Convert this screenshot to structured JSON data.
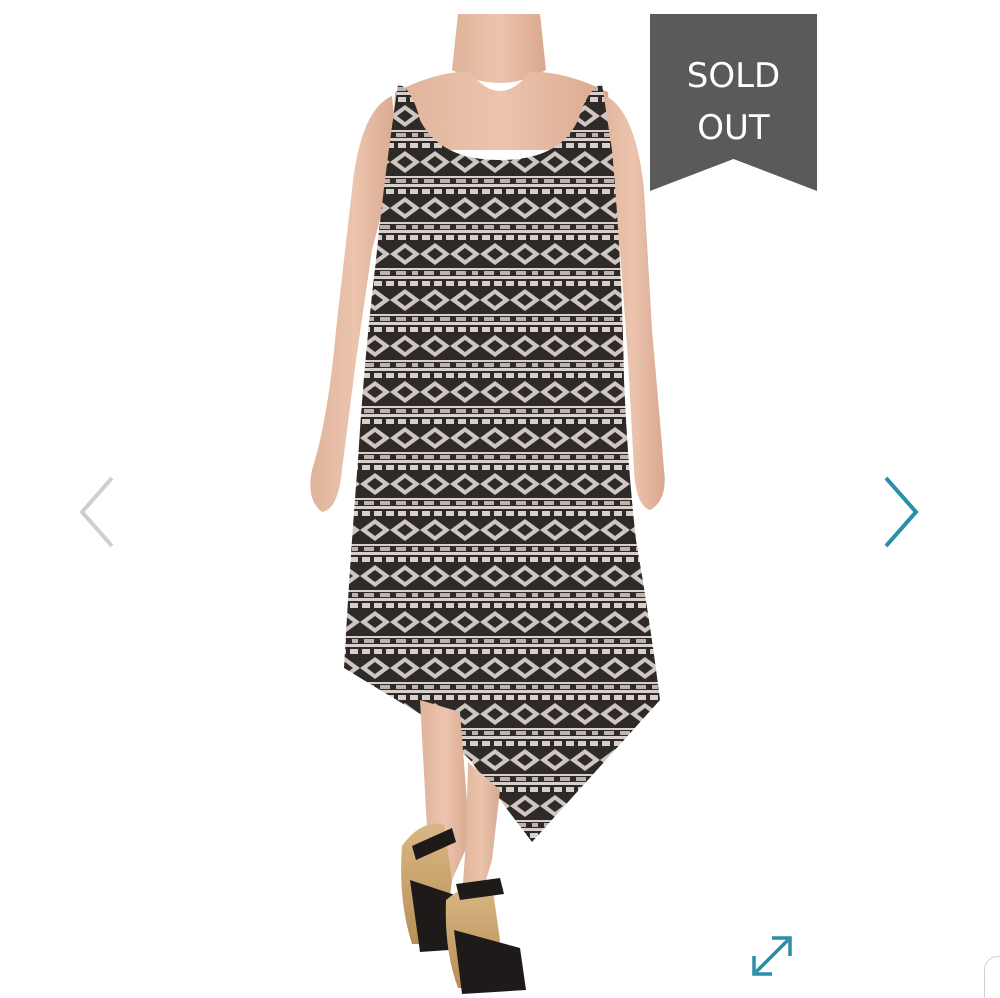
{
  "badge": {
    "line1": "SOLD",
    "line2": "OUT",
    "color": "#5a5a5a"
  },
  "navigation": {
    "prev_icon": "chevron-left-icon",
    "next_icon": "chevron-right-icon",
    "prev_color": "#cfcfcf",
    "next_color": "#2a8fa8"
  },
  "expand": {
    "icon": "expand-arrows-icon",
    "color": "#2a8fa8"
  },
  "image": {
    "subject": "product-photo"
  }
}
